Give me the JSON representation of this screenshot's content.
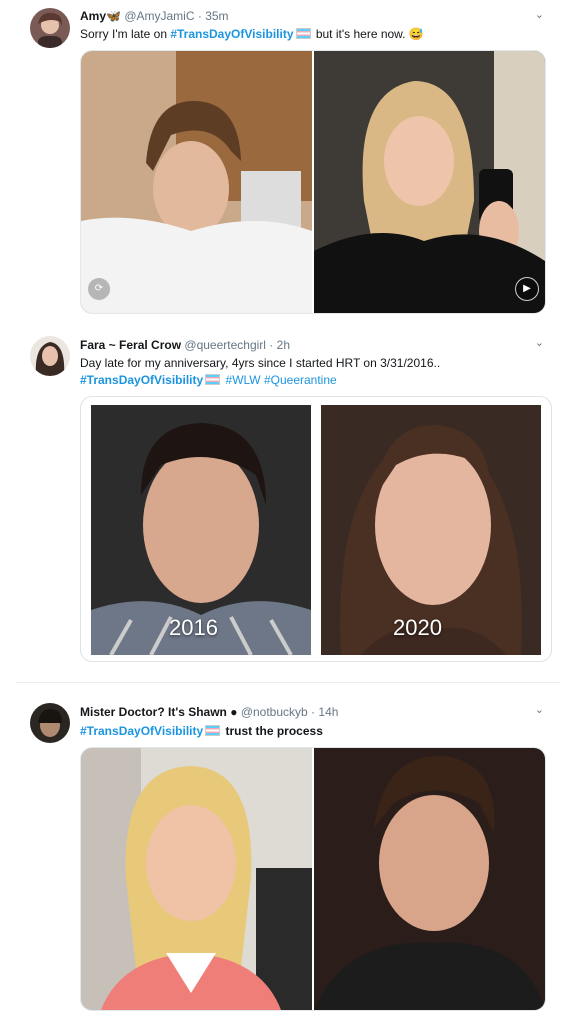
{
  "tweets": [
    {
      "name": "Amy",
      "name_suffix": "🦋",
      "handle": "@AmyJamiC",
      "time": "35m",
      "text_parts": [
        "Sorry I'm late on ",
        "#TransDayOfVisibility",
        " but it's here now. 😅"
      ]
    },
    {
      "name": "Fara ~ Feral Crow",
      "handle": "@queertechgirl",
      "time": "2h",
      "line1": "Day late for my anniversary, 4yrs since I started HRT on 3/31/2016..",
      "line2_parts": [
        "#TransDayOfVisibility",
        "#WLW",
        "#Queerantine"
      ],
      "label_left": "2016",
      "label_right": "2020"
    },
    {
      "name": "Mister Doctor? It's Shawn",
      "name_suffix": "●",
      "handle": "@notbuckyb",
      "time": "14h",
      "text_parts": [
        "#TransDayOfVisibility",
        " trust the process"
      ]
    }
  ],
  "icons": {
    "caret": "chevron-down-icon",
    "flag": "trans-flag-icon"
  },
  "colors": {
    "link": "#1b95e0",
    "muted": "#657786",
    "text": "#14171a"
  }
}
